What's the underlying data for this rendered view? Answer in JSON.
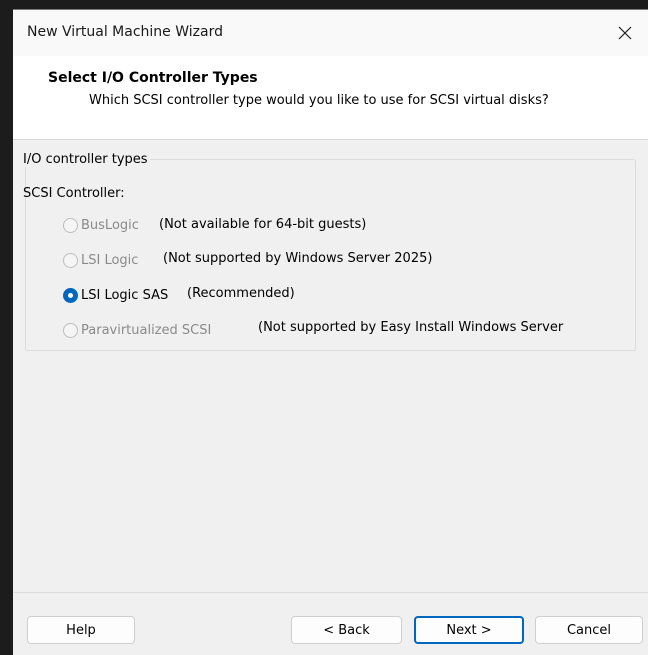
{
  "window": {
    "title": "New Virtual Machine Wizard",
    "close_glyph": "✕"
  },
  "header": {
    "title": "Select I/O Controller Types",
    "subtitle": "Which SCSI controller type would you like to use for SCSI virtual disks?"
  },
  "group": {
    "legend": "I/O controller types",
    "scsi_label": "SCSI Controller:"
  },
  "options": [
    {
      "label": "BusLogic",
      "note": "(Not available for 64-bit guests)",
      "enabled": false,
      "checked": false
    },
    {
      "label": "LSI Logic",
      "note": "(Not supported by Windows Server 2025)",
      "enabled": false,
      "checked": false
    },
    {
      "label": "LSI Logic SAS",
      "note": "(Recommended)",
      "enabled": true,
      "checked": true
    },
    {
      "label": "Paravirtualized SCSI",
      "note": "(Not supported by Easy Install Windows Server",
      "enabled": false,
      "checked": false
    }
  ],
  "buttons": {
    "help": "Help",
    "back": "< Back",
    "next": "Next >",
    "cancel": "Cancel"
  },
  "colors": {
    "accent": "#0067c0",
    "disabled_text": "#8a8a8a"
  }
}
